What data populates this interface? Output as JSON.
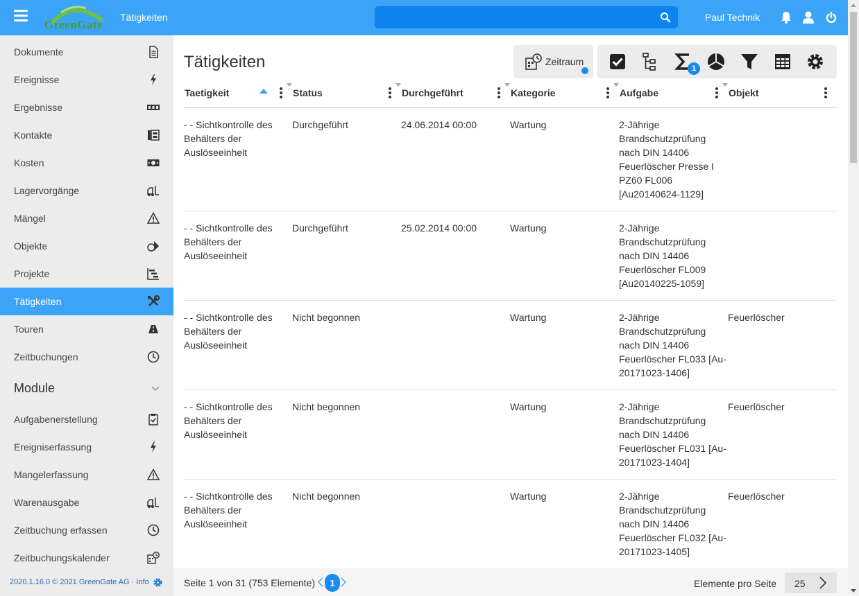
{
  "header": {
    "logo_text": "GreenGate",
    "page_title": "Tätigkeiten",
    "search_placeholder": "",
    "user_name": "Paul Technik"
  },
  "sidebar": {
    "items": [
      {
        "label": "Dokumente",
        "icon": "document-icon"
      },
      {
        "label": "Ereignisse",
        "icon": "lightning-icon"
      },
      {
        "label": "Ergebnisse",
        "icon": "counter-icon"
      },
      {
        "label": "Kontakte",
        "icon": "address-book-icon"
      },
      {
        "label": "Kosten",
        "icon": "money-icon"
      },
      {
        "label": "Lagervorgänge",
        "icon": "forklift-icon"
      },
      {
        "label": "Mängel",
        "icon": "warning-icon"
      },
      {
        "label": "Objekte",
        "icon": "shapes-icon"
      },
      {
        "label": "Projekte",
        "icon": "gantt-icon"
      },
      {
        "label": "Tätigkeiten",
        "icon": "tools-icon",
        "active": true
      },
      {
        "label": "Touren",
        "icon": "road-icon"
      },
      {
        "label": "Zeitbuchungen",
        "icon": "clock-icon"
      }
    ],
    "module_header": "Module",
    "modules": [
      {
        "label": "Aufgabenerstellung",
        "icon": "clipboard-check-icon"
      },
      {
        "label": "Ereigniserfassung",
        "icon": "lightning-icon"
      },
      {
        "label": "Mangelerfassung",
        "icon": "warning-icon"
      },
      {
        "label": "Warenausgabe",
        "icon": "forklift-icon"
      },
      {
        "label": "Zeitbuchung erfassen",
        "icon": "clock-icon"
      },
      {
        "label": "Zeitbuchungskalender",
        "icon": "calendar-clock-icon"
      }
    ],
    "footer_text": "2020.1.16.0 © 2021 GreenGate AG · Info"
  },
  "main": {
    "title": "Tätigkeiten",
    "zeitraum_label": "Zeitraum",
    "sum_badge": "1",
    "columns": [
      "Taetigkeit",
      "Status",
      "Durchgeführt",
      "Kategorie",
      "Aufgabe",
      "Objekt"
    ],
    "rows": [
      {
        "taetigkeit": [
          "- - Sichtkontrolle des",
          "Behälters der",
          "Auslöseeinheit"
        ],
        "status": "Durchgeführt",
        "durchgefuehrt": "24.06.2014 00:00",
        "kategorie": "Wartung",
        "aufgabe": [
          "2-Jährige",
          "Brandschutzprüfung",
          "nach DIN 14406",
          "Feuerlöscher Presse I",
          "PZ60 FL006",
          "[Au20140624-1129]"
        ],
        "objekt": ""
      },
      {
        "taetigkeit": [
          "- - Sichtkontrolle des",
          "Behälters der",
          "Auslöseeinheit"
        ],
        "status": "Durchgeführt",
        "durchgefuehrt": "25.02.2014 00:00",
        "kategorie": "Wartung",
        "aufgabe": [
          "2-Jährige",
          "Brandschutzprüfung",
          "nach DIN 14406",
          "Feuerlöscher FL009",
          "[Au20140225-1059]"
        ],
        "objekt": ""
      },
      {
        "taetigkeit": [
          "- - Sichtkontrolle des",
          "Behälters der",
          "Auslöseeinheit"
        ],
        "status": "Nicht begonnen",
        "durchgefuehrt": "",
        "kategorie": "Wartung",
        "aufgabe": [
          "2-Jährige",
          "Brandschutzprüfung",
          "nach DIN 14406",
          "Feuerlöscher FL033 [Au-",
          "20171023-1406]"
        ],
        "objekt": "Feuerlöscher"
      },
      {
        "taetigkeit": [
          "- - Sichtkontrolle des",
          "Behälters der",
          "Auslöseeinheit"
        ],
        "status": "Nicht begonnen",
        "durchgefuehrt": "",
        "kategorie": "Wartung",
        "aufgabe": [
          "2-Jährige",
          "Brandschutzprüfung",
          "nach DIN 14406",
          "Feuerlöscher FL031 [Au-",
          "20171023-1404]"
        ],
        "objekt": "Feuerlöscher"
      },
      {
        "taetigkeit": [
          "- - Sichtkontrolle des",
          "Behälters der",
          "Auslöseeinheit"
        ],
        "status": "Nicht begonnen",
        "durchgefuehrt": "",
        "kategorie": "Wartung",
        "aufgabe": [
          "2-Jährige",
          "Brandschutzprüfung",
          "nach DIN 14406",
          "Feuerlöscher FL032 [Au-",
          "20171023-1405]"
        ],
        "objekt": "Feuerlöscher"
      }
    ]
  },
  "footer": {
    "page_info": "Seite 1 von 31 (753 Elemente)",
    "current_page": "1",
    "per_page_label": "Elemente pro Seite",
    "per_page_value": "25"
  },
  "colors": {
    "accent": "#3ba4f6",
    "search_bg": "#0d83ee",
    "badge": "#1a8cf0",
    "sidebar_bg": "#ececec"
  }
}
